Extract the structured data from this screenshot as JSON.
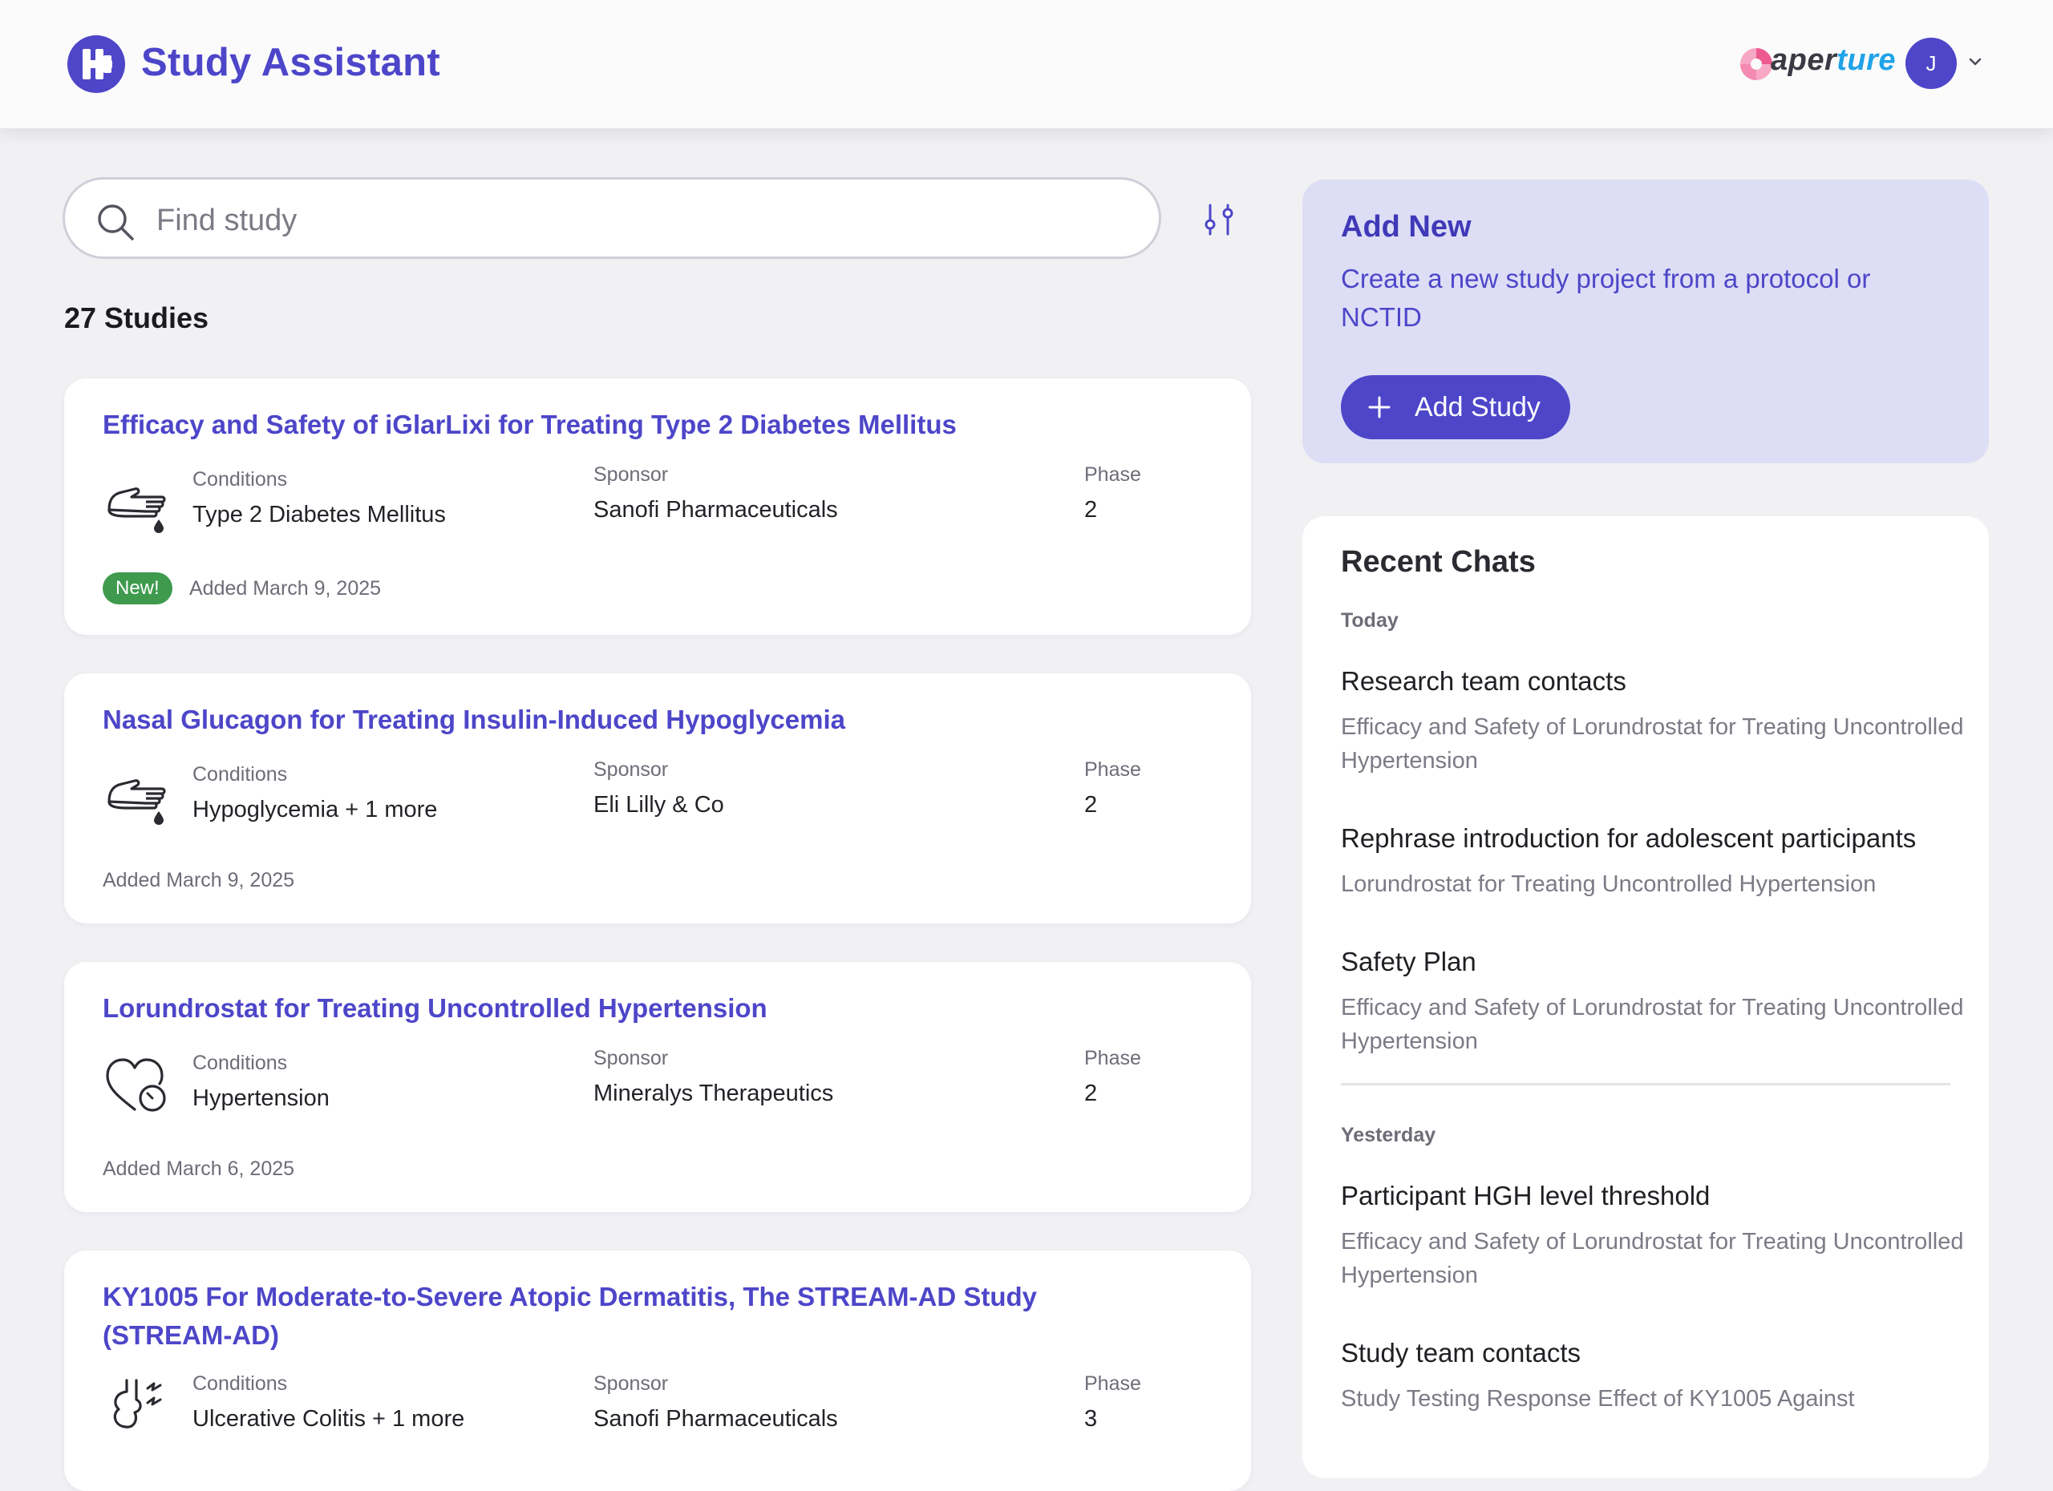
{
  "header": {
    "app_title": "Study Assistant",
    "partner_logo_prefix": "aper",
    "partner_logo_accent": "ture",
    "avatar_initial": "J",
    "brand_color": "#4d46c9"
  },
  "search": {
    "placeholder": "Find study"
  },
  "studies_count_label": "27 Studies",
  "field_labels": {
    "conditions": "Conditions",
    "sponsor": "Sponsor",
    "phase": "Phase"
  },
  "studies": [
    {
      "title": "Efficacy and Safety of iGlarLixi for Treating Type 2 Diabetes Mellitus",
      "conditions": "Type 2 Diabetes Mellitus",
      "sponsor": "Sanofi Pharmaceuticals",
      "phase": "2",
      "badge": "New!",
      "added": "Added March 9, 2025",
      "icon": "hand-drop-icon"
    },
    {
      "title": "Nasal Glucagon for Treating Insulin-Induced Hypoglycemia",
      "conditions": "Hypoglycemia + 1 more",
      "sponsor": "Eli Lilly & Co",
      "phase": "2",
      "added": "Added March 9, 2025",
      "icon": "hand-drop-icon"
    },
    {
      "title": "Lorundrostat for Treating Uncontrolled Hypertension",
      "conditions": "Hypertension",
      "sponsor": "Mineralys Therapeutics",
      "phase": "2",
      "added": "Added March 6, 2025",
      "icon": "heart-gauge-icon"
    },
    {
      "title": "KY1005 For Moderate-to-Severe Atopic Dermatitis, The STREAM-AD Study (STREAM-AD)",
      "conditions": "Ulcerative Colitis + 1 more",
      "sponsor": "Sanofi Pharmaceuticals",
      "phase": "3",
      "icon": "stomach-icon"
    }
  ],
  "add_new": {
    "title": "Add New",
    "description": "Create a new study project from a protocol or NCTID",
    "button_label": "Add Study"
  },
  "recent_chats": {
    "title": "Recent Chats",
    "groups": [
      {
        "label": "Today",
        "items": [
          {
            "title": "Research team contacts",
            "study": "Efficacy and Safety of Lorundrostat for Treating Uncontrolled Hypertension"
          },
          {
            "title": "Rephrase introduction for adolescent participants",
            "study": "Lorundrostat for Treating Uncontrolled Hypertension"
          },
          {
            "title": "Safety Plan",
            "study": "Efficacy and Safety of Lorundrostat for Treating Uncontrolled Hypertension"
          }
        ]
      },
      {
        "label": "Yesterday",
        "items": [
          {
            "title": "Participant HGH level threshold",
            "study": "Efficacy and Safety of Lorundrostat for Treating Uncontrolled Hypertension"
          },
          {
            "title": "Study team contacts",
            "study": "Study Testing Response Effect of KY1005 Against"
          }
        ]
      }
    ]
  }
}
